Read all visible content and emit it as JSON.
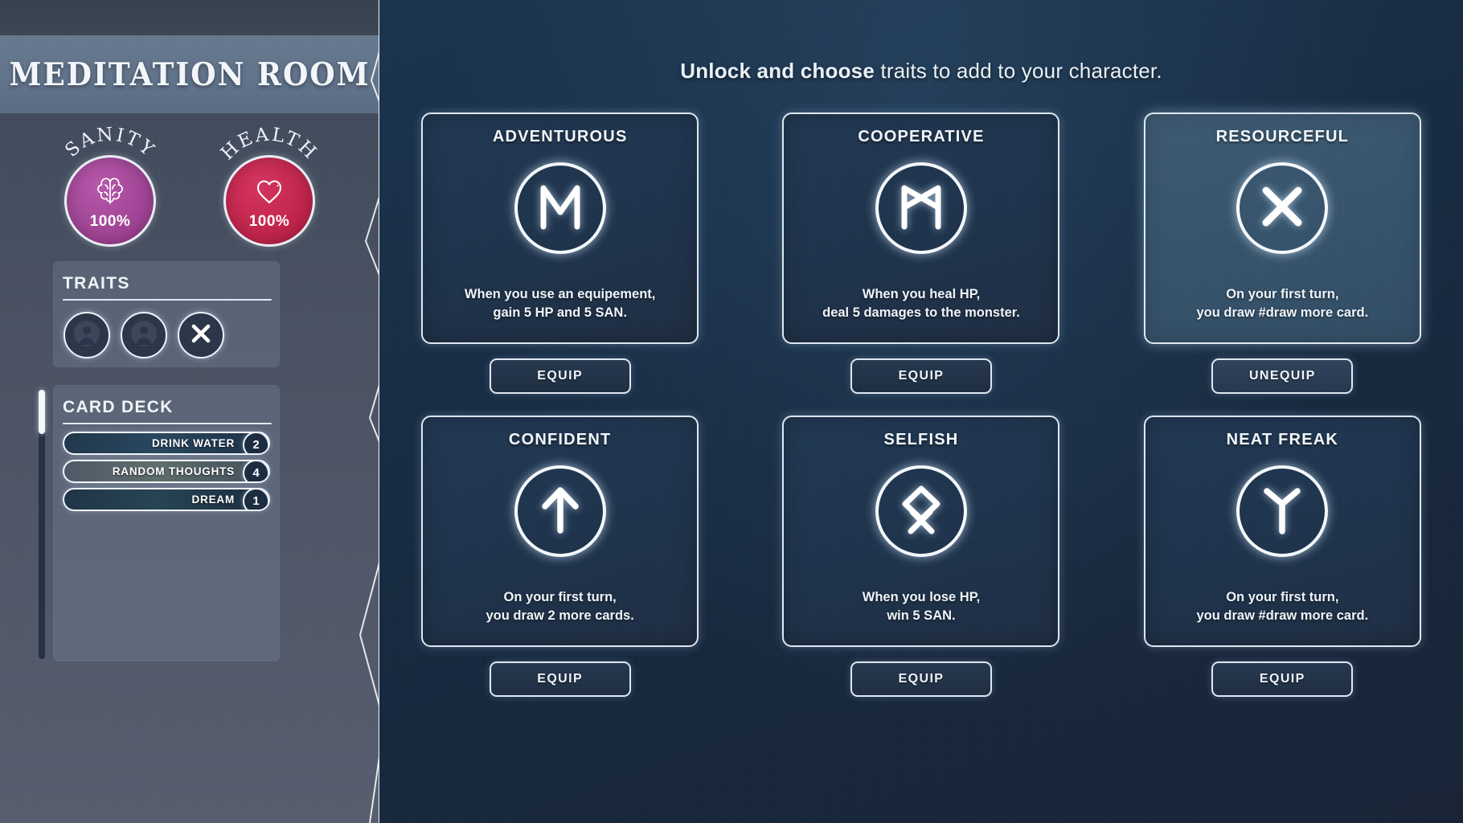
{
  "sidebar": {
    "title": "MEDITATION ROOM",
    "stats": [
      {
        "label": "SANITY",
        "value": "100%",
        "icon": "brain-icon",
        "color": "#9e3f92"
      },
      {
        "label": "HEALTH",
        "value": "100%",
        "icon": "heart-icon",
        "color": "#c01f47"
      }
    ],
    "traits_panel": {
      "title": "TRAITS",
      "slots": [
        {
          "icon": "person-placeholder-icon",
          "state": "empty"
        },
        {
          "icon": "person-placeholder-icon",
          "state": "empty"
        },
        {
          "icon": "x-rune-icon",
          "state": "filled"
        }
      ]
    },
    "deck_panel": {
      "title": "CARD DECK",
      "cards": [
        {
          "name": "DRINK WATER",
          "count": "2"
        },
        {
          "name": "RANDOM THOUGHTS",
          "count": "4"
        },
        {
          "name": "DREAM",
          "count": "1"
        }
      ]
    }
  },
  "main": {
    "heading_bold": "Unlock and choose",
    "heading_rest": " traits to add to your character.",
    "traits": [
      {
        "name": "ADVENTUROUS",
        "rune": "ehwaz-m-rune-icon",
        "desc_line1": "When you use an equipement,",
        "desc_line2": "gain 5 HP and 5 SAN.",
        "button": "EQUIP",
        "equipped": false
      },
      {
        "name": "COOPERATIVE",
        "rune": "dagaz-crossed-m-rune-icon",
        "desc_line1": "When you heal HP,",
        "desc_line2": "deal 5 damages to the monster.",
        "button": "EQUIP",
        "equipped": false
      },
      {
        "name": "RESOURCEFUL",
        "rune": "gebo-x-rune-icon",
        "desc_line1": "On your first turn,",
        "desc_line2": "you draw #draw more card.",
        "button": "UNEQUIP",
        "equipped": true
      },
      {
        "name": "CONFIDENT",
        "rune": "tiwaz-arrow-rune-icon",
        "desc_line1": "On your first turn,",
        "desc_line2": "you draw 2 more cards.",
        "button": "EQUIP",
        "equipped": false
      },
      {
        "name": "SELFISH",
        "rune": "othala-rune-icon",
        "desc_line1": "When you lose HP,",
        "desc_line2": "win 5 SAN.",
        "button": "EQUIP",
        "equipped": false
      },
      {
        "name": "NEAT FREAK",
        "rune": "algiz-rune-icon",
        "desc_line1": "On your first turn,",
        "desc_line2": "you draw #draw more card.",
        "button": "EQUIP",
        "equipped": false
      }
    ]
  },
  "colors": {
    "sanity": "#9e3f92",
    "health": "#c01f47",
    "panel_bg": "#43506a",
    "card_border": "#dde7f1",
    "main_bg": "#14263c",
    "selected_card": "#345369"
  }
}
